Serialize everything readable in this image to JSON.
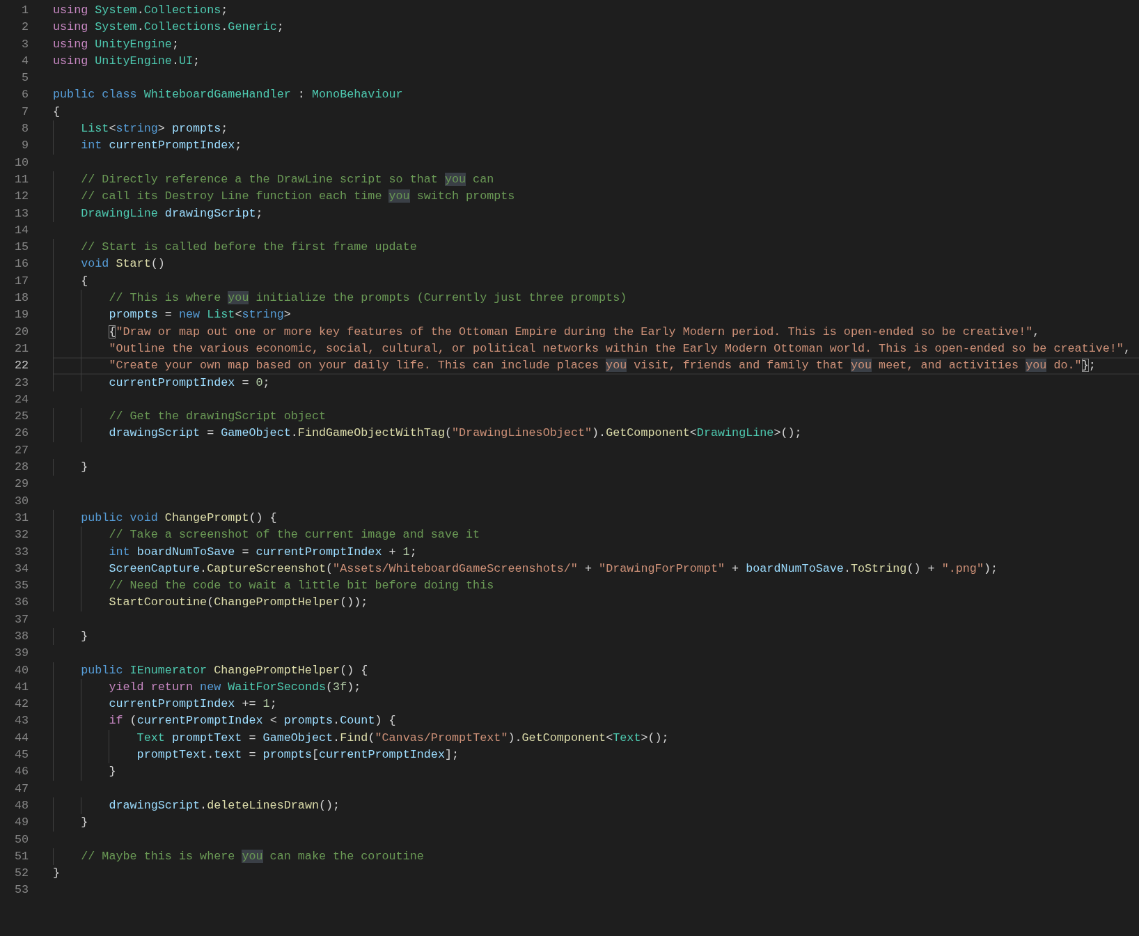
{
  "editor": {
    "lines": [
      {
        "number": "1",
        "current": false,
        "tokens": [
          {
            "kind": "kw",
            "text": "using "
          },
          {
            "kind": "ty",
            "text": "System"
          },
          {
            "kind": "p",
            "text": "."
          },
          {
            "kind": "ty",
            "text": "Collections"
          },
          {
            "kind": "p",
            "text": ";"
          }
        ]
      },
      {
        "number": "2",
        "current": false,
        "tokens": [
          {
            "kind": "kw",
            "text": "using "
          },
          {
            "kind": "ty",
            "text": "System"
          },
          {
            "kind": "p",
            "text": "."
          },
          {
            "kind": "ty",
            "text": "Collections"
          },
          {
            "kind": "p",
            "text": "."
          },
          {
            "kind": "ty",
            "text": "Generic"
          },
          {
            "kind": "p",
            "text": ";"
          }
        ]
      },
      {
        "number": "3",
        "current": false,
        "tokens": [
          {
            "kind": "kw",
            "text": "using "
          },
          {
            "kind": "ty",
            "text": "UnityEngine"
          },
          {
            "kind": "p",
            "text": ";"
          }
        ]
      },
      {
        "number": "4",
        "current": false,
        "tokens": [
          {
            "kind": "kw",
            "text": "using "
          },
          {
            "kind": "ty",
            "text": "UnityEngine"
          },
          {
            "kind": "p",
            "text": "."
          },
          {
            "kind": "ty",
            "text": "UI"
          },
          {
            "kind": "p",
            "text": ";"
          }
        ]
      },
      {
        "number": "5",
        "current": false
      },
      {
        "number": "6",
        "current": false,
        "tokens": [
          {
            "kind": "st",
            "text": "public class "
          },
          {
            "kind": "ty",
            "text": "WhiteboardGameHandler"
          },
          {
            "kind": "p",
            "text": " : "
          },
          {
            "kind": "ty",
            "text": "MonoBehaviour"
          }
        ]
      },
      {
        "number": "7",
        "current": false,
        "tokens": [
          {
            "kind": "p",
            "text": "{"
          }
        ]
      },
      {
        "number": "8",
        "current": false,
        "tokens": [
          {
            "kind": "ty",
            "text": "    List"
          },
          {
            "kind": "p",
            "text": "<"
          },
          {
            "kind": "st",
            "text": "string"
          },
          {
            "kind": "p",
            "text": "> "
          },
          {
            "kind": "va",
            "text": "prompts"
          },
          {
            "kind": "p",
            "text": ";"
          }
        ]
      },
      {
        "number": "9",
        "current": false,
        "tokens": [
          {
            "kind": "st",
            "text": "    int "
          },
          {
            "kind": "va",
            "text": "currentPromptIndex"
          },
          {
            "kind": "p",
            "text": ";"
          }
        ]
      },
      {
        "number": "10",
        "current": false
      },
      {
        "number": "11",
        "current": false,
        "tokens": [
          {
            "kind": "com",
            "text": "    // Directly reference a the DrawLine script so that "
          },
          {
            "kind": "com-hl",
            "text": "you"
          },
          {
            "kind": "com",
            "text": " can"
          }
        ]
      },
      {
        "number": "12",
        "current": false,
        "tokens": [
          {
            "kind": "com",
            "text": "    // call its Destroy Line function each time "
          },
          {
            "kind": "com-hl",
            "text": "you"
          },
          {
            "kind": "com",
            "text": " switch prompts"
          }
        ]
      },
      {
        "number": "13",
        "current": false,
        "tokens": [
          {
            "kind": "ty",
            "text": "    DrawingLine "
          },
          {
            "kind": "va",
            "text": "drawingScript"
          },
          {
            "kind": "p",
            "text": ";"
          }
        ]
      },
      {
        "number": "14",
        "current": false
      },
      {
        "number": "15",
        "current": false,
        "tokens": [
          {
            "kind": "com",
            "text": "    // Start is called before the first frame update"
          }
        ]
      },
      {
        "number": "16",
        "current": false,
        "tokens": [
          {
            "kind": "st",
            "text": "    void "
          },
          {
            "kind": "fn",
            "text": "Start"
          },
          {
            "kind": "p",
            "text": "()"
          }
        ]
      },
      {
        "number": "17",
        "current": false,
        "tokens": [
          {
            "kind": "p",
            "text": "    {"
          }
        ]
      },
      {
        "number": "18",
        "current": false,
        "tokens": [
          {
            "kind": "com",
            "text": "        // This is where "
          },
          {
            "kind": "com-hl",
            "text": "you"
          },
          {
            "kind": "com",
            "text": " initialize the prompts (Currently just three prompts)"
          }
        ]
      },
      {
        "number": "19",
        "current": false,
        "tokens": [
          {
            "kind": "va",
            "text": "        prompts"
          },
          {
            "kind": "p",
            "text": " = "
          },
          {
            "kind": "st",
            "text": "new "
          },
          {
            "kind": "ty",
            "text": "List"
          },
          {
            "kind": "p",
            "text": "<"
          },
          {
            "kind": "st",
            "text": "string"
          },
          {
            "kind": "p",
            "text": ">"
          }
        ]
      },
      {
        "number": "20",
        "current": false,
        "tokens": [
          {
            "kind": "br",
            "text": "        {"
          },
          {
            "kind": "str",
            "text": "\"Draw or map out one or more key features of the Ottoman Empire during the Early Modern period. This is open-ended so be creative!\""
          },
          {
            "kind": "p",
            "text": ","
          }
        ]
      },
      {
        "number": "21",
        "current": false,
        "tokens": [
          {
            "kind": "str",
            "text": "        \"Outline the various economic, social, cultural, or political networks within the Early Modern Ottoman world. This is open-ended so be creative!\""
          },
          {
            "kind": "p",
            "text": ","
          }
        ]
      },
      {
        "number": "22",
        "current": true,
        "tokens": [
          {
            "kind": "str",
            "text": "        \"Create your own map based on your daily life. This can include places "
          },
          {
            "kind": "str-hl",
            "text": "you"
          },
          {
            "kind": "str",
            "text": " visit, friends and family that "
          },
          {
            "kind": "str-hl",
            "text": "you"
          },
          {
            "kind": "str",
            "text": " meet, and activities "
          },
          {
            "kind": "str-hl",
            "text": "you"
          },
          {
            "kind": "str",
            "text": " do.\""
          },
          {
            "kind": "br",
            "text": "}"
          },
          {
            "kind": "p",
            "text": ";"
          }
        ]
      },
      {
        "number": "23",
        "current": false,
        "tokens": [
          {
            "kind": "va",
            "text": "        currentPromptIndex"
          },
          {
            "kind": "p",
            "text": " = "
          },
          {
            "kind": "num",
            "text": "0"
          },
          {
            "kind": "p",
            "text": ";"
          }
        ]
      },
      {
        "number": "24",
        "current": false
      },
      {
        "number": "25",
        "current": false,
        "tokens": [
          {
            "kind": "com",
            "text": "        // Get the drawingScript object"
          }
        ]
      },
      {
        "number": "26",
        "current": false,
        "tokens": [
          {
            "kind": "va",
            "text": "        drawingScript"
          },
          {
            "kind": "p",
            "text": " = "
          },
          {
            "kind": "va",
            "text": "GameObject"
          },
          {
            "kind": "p",
            "text": "."
          },
          {
            "kind": "fn",
            "text": "FindGameObjectWithTag"
          },
          {
            "kind": "p",
            "text": "("
          },
          {
            "kind": "str",
            "text": "\"DrawingLinesObject\""
          },
          {
            "kind": "p",
            "text": ")."
          },
          {
            "kind": "fn",
            "text": "GetComponent"
          },
          {
            "kind": "p",
            "text": "<"
          },
          {
            "kind": "ty",
            "text": "DrawingLine"
          },
          {
            "kind": "p",
            "text": ">();"
          }
        ]
      },
      {
        "number": "27",
        "current": false
      },
      {
        "number": "28",
        "current": false,
        "tokens": [
          {
            "kind": "p",
            "text": "    }"
          }
        ]
      },
      {
        "number": "29",
        "current": false
      },
      {
        "number": "30",
        "current": false
      },
      {
        "number": "31",
        "current": false,
        "tokens": [
          {
            "kind": "st",
            "text": "    public void "
          },
          {
            "kind": "fn",
            "text": "ChangePrompt"
          },
          {
            "kind": "p",
            "text": "() {"
          }
        ]
      },
      {
        "number": "32",
        "current": false,
        "tokens": [
          {
            "kind": "com",
            "text": "        // Take a screenshot of the current image and save it"
          }
        ]
      },
      {
        "number": "33",
        "current": false,
        "tokens": [
          {
            "kind": "st",
            "text": "        int "
          },
          {
            "kind": "va",
            "text": "boardNumToSave"
          },
          {
            "kind": "p",
            "text": " = "
          },
          {
            "kind": "va",
            "text": "currentPromptIndex"
          },
          {
            "kind": "p",
            "text": " + "
          },
          {
            "kind": "num",
            "text": "1"
          },
          {
            "kind": "p",
            "text": ";"
          }
        ]
      },
      {
        "number": "34",
        "current": false,
        "tokens": [
          {
            "kind": "va",
            "text": "        ScreenCapture"
          },
          {
            "kind": "p",
            "text": "."
          },
          {
            "kind": "fn",
            "text": "CaptureScreenshot"
          },
          {
            "kind": "p",
            "text": "("
          },
          {
            "kind": "str",
            "text": "\"Assets/WhiteboardGameScreenshots/\""
          },
          {
            "kind": "p",
            "text": " + "
          },
          {
            "kind": "str",
            "text": "\"DrawingForPrompt\""
          },
          {
            "kind": "p",
            "text": " + "
          },
          {
            "kind": "va",
            "text": "boardNumToSave"
          },
          {
            "kind": "p",
            "text": "."
          },
          {
            "kind": "fn",
            "text": "ToString"
          },
          {
            "kind": "p",
            "text": "() + "
          },
          {
            "kind": "str",
            "text": "\".png\""
          },
          {
            "kind": "p",
            "text": ");"
          }
        ]
      },
      {
        "number": "35",
        "current": false,
        "tokens": [
          {
            "kind": "com",
            "text": "        // Need the code to wait a little bit before doing this"
          }
        ]
      },
      {
        "number": "36",
        "current": false,
        "tokens": [
          {
            "kind": "fn",
            "text": "        StartCoroutine"
          },
          {
            "kind": "p",
            "text": "("
          },
          {
            "kind": "fn",
            "text": "ChangePromptHelper"
          },
          {
            "kind": "p",
            "text": "());"
          }
        ]
      },
      {
        "number": "37",
        "current": false
      },
      {
        "number": "38",
        "current": false,
        "tokens": [
          {
            "kind": "p",
            "text": "    }"
          }
        ]
      },
      {
        "number": "39",
        "current": false
      },
      {
        "number": "40",
        "current": false,
        "tokens": [
          {
            "kind": "st",
            "text": "    public "
          },
          {
            "kind": "ty",
            "text": "IEnumerator "
          },
          {
            "kind": "fn",
            "text": "ChangePromptHelper"
          },
          {
            "kind": "p",
            "text": "() {"
          }
        ]
      },
      {
        "number": "41",
        "current": false,
        "tokens": [
          {
            "kind": "kw",
            "text": "        yield return "
          },
          {
            "kind": "st",
            "text": "new "
          },
          {
            "kind": "ty",
            "text": "WaitForSeconds"
          },
          {
            "kind": "p",
            "text": "("
          },
          {
            "kind": "num",
            "text": "3f"
          },
          {
            "kind": "p",
            "text": ");"
          }
        ]
      },
      {
        "number": "42",
        "current": false,
        "tokens": [
          {
            "kind": "va",
            "text": "        currentPromptIndex"
          },
          {
            "kind": "p",
            "text": " += "
          },
          {
            "kind": "num",
            "text": "1"
          },
          {
            "kind": "p",
            "text": ";"
          }
        ]
      },
      {
        "number": "43",
        "current": false,
        "tokens": [
          {
            "kind": "kw",
            "text": "        if"
          },
          {
            "kind": "p",
            "text": " ("
          },
          {
            "kind": "va",
            "text": "currentPromptIndex"
          },
          {
            "kind": "p",
            "text": " < "
          },
          {
            "kind": "va",
            "text": "prompts"
          },
          {
            "kind": "p",
            "text": "."
          },
          {
            "kind": "va",
            "text": "Count"
          },
          {
            "kind": "p",
            "text": ") {"
          }
        ]
      },
      {
        "number": "44",
        "current": false,
        "tokens": [
          {
            "kind": "ty",
            "text": "            Text "
          },
          {
            "kind": "va",
            "text": "promptText"
          },
          {
            "kind": "p",
            "text": " = "
          },
          {
            "kind": "va",
            "text": "GameObject"
          },
          {
            "kind": "p",
            "text": "."
          },
          {
            "kind": "fn",
            "text": "Find"
          },
          {
            "kind": "p",
            "text": "("
          },
          {
            "kind": "str",
            "text": "\"Canvas/PromptText\""
          },
          {
            "kind": "p",
            "text": ")."
          },
          {
            "kind": "fn",
            "text": "GetComponent"
          },
          {
            "kind": "p",
            "text": "<"
          },
          {
            "kind": "ty",
            "text": "Text"
          },
          {
            "kind": "p",
            "text": ">();"
          }
        ]
      },
      {
        "number": "45",
        "current": false,
        "tokens": [
          {
            "kind": "va",
            "text": "            promptText"
          },
          {
            "kind": "p",
            "text": "."
          },
          {
            "kind": "va",
            "text": "text"
          },
          {
            "kind": "p",
            "text": " = "
          },
          {
            "kind": "va",
            "text": "prompts"
          },
          {
            "kind": "p",
            "text": "["
          },
          {
            "kind": "va",
            "text": "currentPromptIndex"
          },
          {
            "kind": "p",
            "text": "];"
          }
        ]
      },
      {
        "number": "46",
        "current": false,
        "tokens": [
          {
            "kind": "p",
            "text": "        }"
          }
        ]
      },
      {
        "number": "47",
        "current": false
      },
      {
        "number": "48",
        "current": false,
        "tokens": [
          {
            "kind": "va",
            "text": "        drawingScript"
          },
          {
            "kind": "p",
            "text": "."
          },
          {
            "kind": "fn",
            "text": "deleteLinesDrawn"
          },
          {
            "kind": "p",
            "text": "();"
          }
        ]
      },
      {
        "number": "49",
        "current": false,
        "tokens": [
          {
            "kind": "p",
            "text": "    }"
          }
        ]
      },
      {
        "number": "50",
        "current": false
      },
      {
        "number": "51",
        "current": false,
        "tokens": [
          {
            "kind": "com",
            "text": "    // Maybe this is where "
          },
          {
            "kind": "com-hl",
            "text": "you"
          },
          {
            "kind": "com",
            "text": " can make the coroutine"
          }
        ]
      },
      {
        "number": "52",
        "current": false,
        "tokens": [
          {
            "kind": "p",
            "text": "}"
          }
        ]
      },
      {
        "number": "53",
        "current": false
      }
    ]
  }
}
